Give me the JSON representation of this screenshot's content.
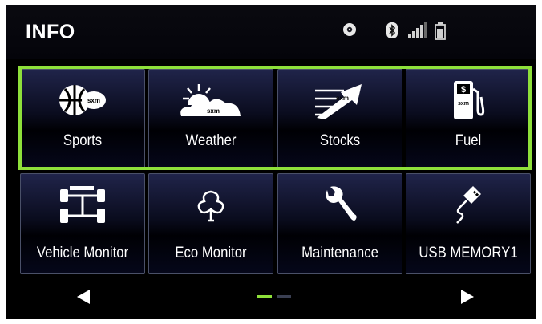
{
  "header": {
    "title": "INFO",
    "status_icons": [
      "cd-icon",
      "bluetooth-icon",
      "signal-icon",
      "battery-icon"
    ]
  },
  "tiles": [
    {
      "label": "Sports",
      "icon": "sports-sxm-icon"
    },
    {
      "label": "Weather",
      "icon": "weather-sxm-icon"
    },
    {
      "label": "Stocks",
      "icon": "stocks-sxm-icon"
    },
    {
      "label": "Fuel",
      "icon": "fuel-sxm-icon"
    },
    {
      "label": "Vehicle Monitor",
      "icon": "vehicle-monitor-icon"
    },
    {
      "label": "Eco Monitor",
      "icon": "eco-monitor-icon"
    },
    {
      "label": "Maintenance",
      "icon": "maintenance-wrench-icon"
    },
    {
      "label": "USB MEMORY1",
      "icon": "usb-icon"
    }
  ],
  "sxm_badge": "sxm",
  "pagination": {
    "current_page": 1,
    "total_pages": 2
  },
  "colors": {
    "highlight": "#8ee03a",
    "background": "#000000",
    "text": "#ffffff"
  }
}
